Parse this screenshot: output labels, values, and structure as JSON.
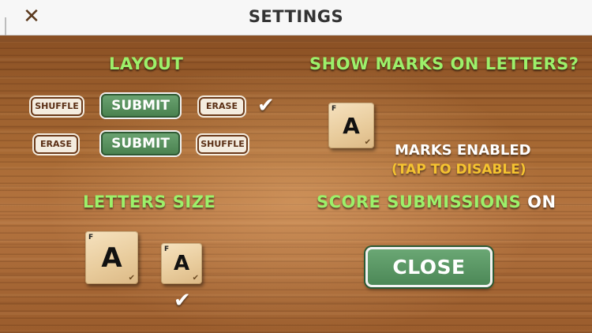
{
  "header": {
    "close_icon": "✕",
    "title": "SETTINGS"
  },
  "layout_section": {
    "heading": "LAYOUT",
    "row1": {
      "left": "SHUFFLE",
      "center": "SUBMIT",
      "right": "ERASE",
      "selected": true
    },
    "row2": {
      "left": "ERASE",
      "center": "SUBMIT",
      "right": "SHUFFLE",
      "selected": false
    },
    "check_icon": "✔"
  },
  "marks_section": {
    "heading": "SHOW MARKS ON LETTERS?",
    "tile_letter": "A",
    "tile_corner": "F",
    "status": "MARKS ENABLED",
    "action": "(TAP TO DISABLE)"
  },
  "letters_size_section": {
    "heading": "LETTERS SIZE",
    "large_tile": {
      "letter": "A",
      "corner": "F"
    },
    "small_tile": {
      "letter": "A",
      "corner": "F"
    },
    "selected": "small",
    "check_icon": "✔"
  },
  "score_section": {
    "heading": "SCORE SUBMISSIONS",
    "state": "ON"
  },
  "close_button": {
    "label": "CLOSE"
  },
  "colors": {
    "heading_green": "#9cf06a",
    "submit_green": "#4a8250",
    "warning_yellow": "#f5c330",
    "wood": "#9b5f2d"
  }
}
